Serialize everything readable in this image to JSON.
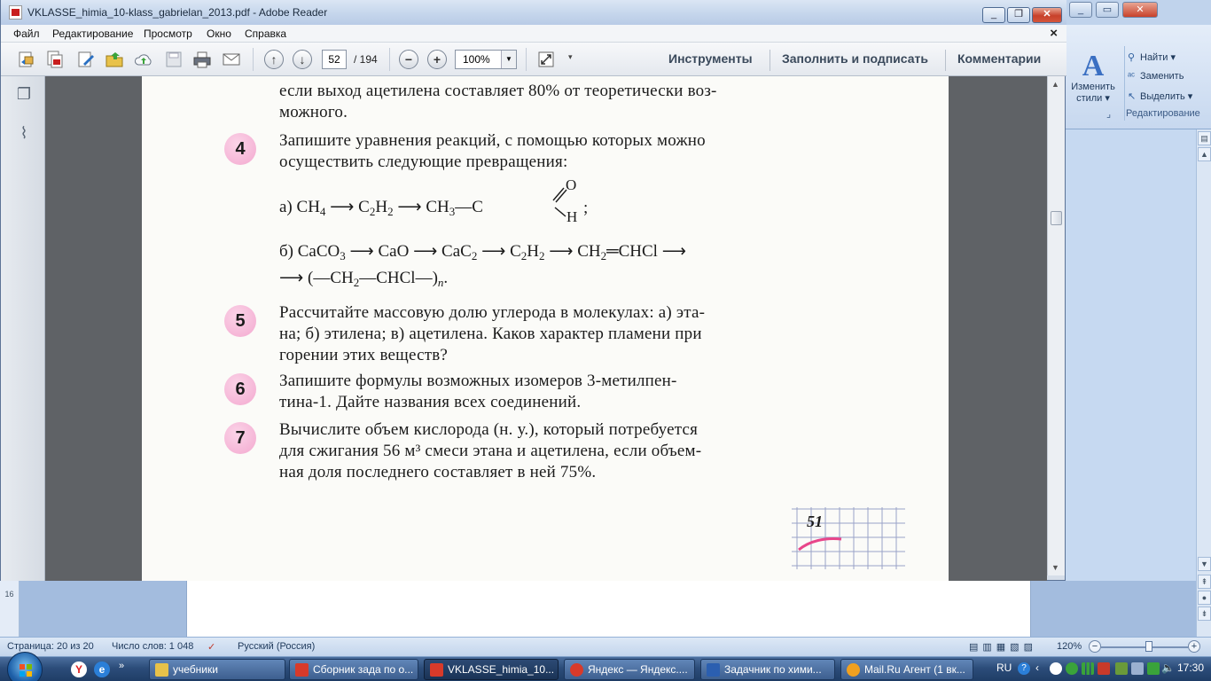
{
  "reader": {
    "title": "VKLASSE_himia_10-klass_gabrielan_2013.pdf - Adobe Reader",
    "menu": [
      "Файл",
      "Редактирование",
      "Просмотр",
      "Окно",
      "Справка"
    ],
    "page_current": "52",
    "page_total": "/ 194",
    "zoom": "100%",
    "links": {
      "tools": "Инструменты",
      "sign": "Заполнить и подписать",
      "comments": "Комментарии"
    }
  },
  "pdf": {
    "prev_text_line1": "если выход ацетилена составляет 80% от теоретически воз-",
    "prev_text_line2": "можного.",
    "tasks": [
      {
        "num": "4",
        "lines": [
          "Запишите уравнения реакций, с помощью которых можно",
          "осуществить следующие превращения:"
        ]
      },
      {
        "num": "5",
        "lines": [
          "Рассчитайте массовую долю углерода в молекулах: а) эта-",
          "на; б) этилена; в) ацетилена. Каков характер пламени при",
          "горении этих веществ?"
        ]
      },
      {
        "num": "6",
        "lines": [
          "Запишите формулы возможных изомеров 3-метилпен-",
          "тина-1. Дайте названия всех соединений."
        ]
      },
      {
        "num": "7",
        "lines": [
          "Вычислите объем кислорода (н. у.), который потребуется",
          "для сжигания 56 м³ смеси этана и ацетилена, если объем-",
          "ная доля последнего составляет в ней 75%."
        ]
      }
    ],
    "formula_a_prefix": "а)",
    "formula_b_prefix": "б)",
    "page_number": "51"
  },
  "word": {
    "styles_label_1": "Изменить",
    "styles_label_2": "стили",
    "find": "Найти",
    "replace": "Заменить",
    "select": "Выделить",
    "group": "Редактирование",
    "status_page": "Страница: 20 из 20",
    "status_words": "Число слов: 1 048",
    "status_lang": "Русский (Россия)",
    "zoom": "120%",
    "ruler_mark": "16"
  },
  "taskbar": {
    "items": [
      {
        "label": "учебники",
        "color": "#e8c24a"
      },
      {
        "label": "Сборник зада по о...",
        "color": "#d83a2a"
      },
      {
        "label": "VKLASSE_himia_10...",
        "color": "#d83a2a"
      },
      {
        "label": "Яндекс — Яндекс....",
        "color": "#d83a2a"
      },
      {
        "label": "Задачник по хими...",
        "color": "#2b5fb0"
      },
      {
        "label": "Mail.Ru Агент (1 вк...",
        "color": "#f0a020"
      }
    ],
    "lang": "RU",
    "time": "17:30"
  }
}
